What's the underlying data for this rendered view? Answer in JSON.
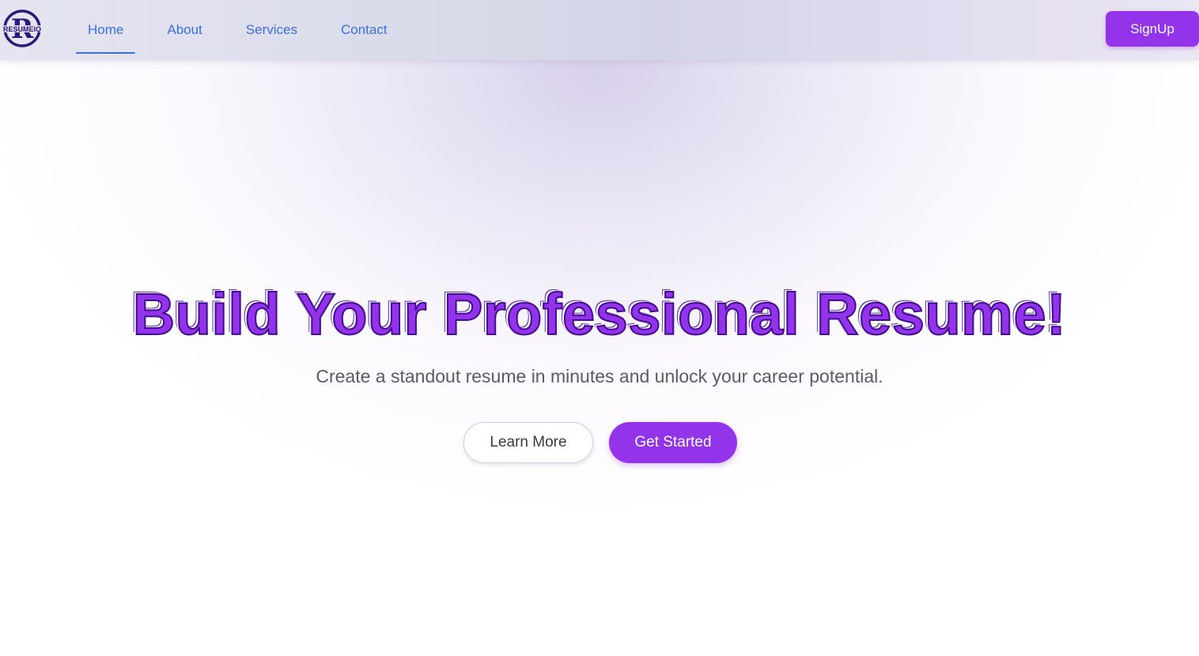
{
  "header": {
    "logo": {
      "text": "RESUMEIQ",
      "letter": "R",
      "icon": "resumeiq-logo-icon"
    },
    "nav": [
      {
        "label": "Home",
        "active": true
      },
      {
        "label": "About",
        "active": false
      },
      {
        "label": "Services",
        "active": false
      },
      {
        "label": "Contact",
        "active": false
      }
    ],
    "signup_label": "SignUp"
  },
  "hero": {
    "title": "Build Your Professional Resume!",
    "subtitle": "Create a standout resume in minutes and unlock your career potential.",
    "secondary_button": "Learn More",
    "primary_button": "Get Started"
  },
  "colors": {
    "accent": "#9333ea",
    "nav_link": "#3b6fe0",
    "logo": "#2b1a78"
  }
}
